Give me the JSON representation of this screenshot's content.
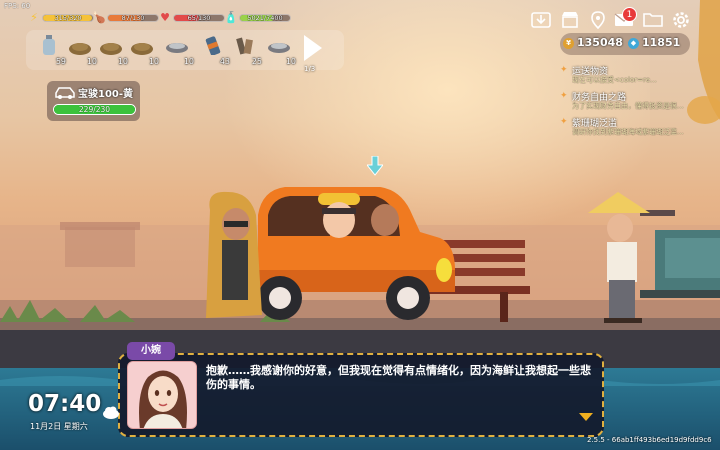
{
  "fps": "FPS: 60",
  "stats": [
    {
      "icon": "energy-icon",
      "text": "315/320",
      "color": "#f5c23a",
      "level": 0.98
    },
    {
      "icon": "hunger-icon",
      "text": "87/130",
      "color": "#e87a3a",
      "level": 0.67
    },
    {
      "icon": "health-icon",
      "text": "65/130",
      "color": "#e24a4a",
      "level": 0.5
    },
    {
      "icon": "thirst-icon",
      "text": "5021/7400",
      "color": "#9ad24a",
      "level": 0.68
    }
  ],
  "inventory": {
    "items": [
      {
        "icon": "bottle-icon",
        "count": "59"
      },
      {
        "icon": "sand-pile-icon",
        "count": "10"
      },
      {
        "icon": "sand-pile-icon",
        "count": "10"
      },
      {
        "icon": "sand-pile-icon",
        "count": "10"
      },
      {
        "icon": "fish-tray-icon",
        "count": "10"
      },
      {
        "icon": "can-icon",
        "count": "43"
      },
      {
        "icon": "scrap-bundle-icon",
        "count": "25"
      },
      {
        "icon": "fish-tray-icon",
        "count": "10"
      }
    ],
    "page": "1/3"
  },
  "vehicle": {
    "name": "宝骏100-黄",
    "durability": "229/230",
    "level": 0.996
  },
  "currency": {
    "gold": "135048",
    "gems": "11851"
  },
  "top_icons": [
    "download-icon",
    "shop-icon",
    "map-pin-icon",
    "mail-icon",
    "folder-icon",
    "gear-icon"
  ],
  "notification_count": "1",
  "quests": [
    {
      "title": "运送物资",
      "desc": "现在可以接受<color=re..."
    },
    {
      "title": "财务自由之路",
      "desc": "为了实现财务自由，懂得投资是很..."
    },
    {
      "title": "紫珊瑚泛滥",
      "desc": "调研你找到紫珊瑚海域紫珊瑚泛滥..."
    }
  ],
  "dialog": {
    "speaker": "小婉",
    "text": "抱歉……我感谢你的好意，但我现在觉得有点情绪化，因为海鲜让我想起一些悲伤的事情。"
  },
  "time": {
    "clock": "07:40",
    "date": "11月2日 星期六"
  },
  "version": "2.5.5 - 66ab1ff493b6ed19d9fdd9c6"
}
